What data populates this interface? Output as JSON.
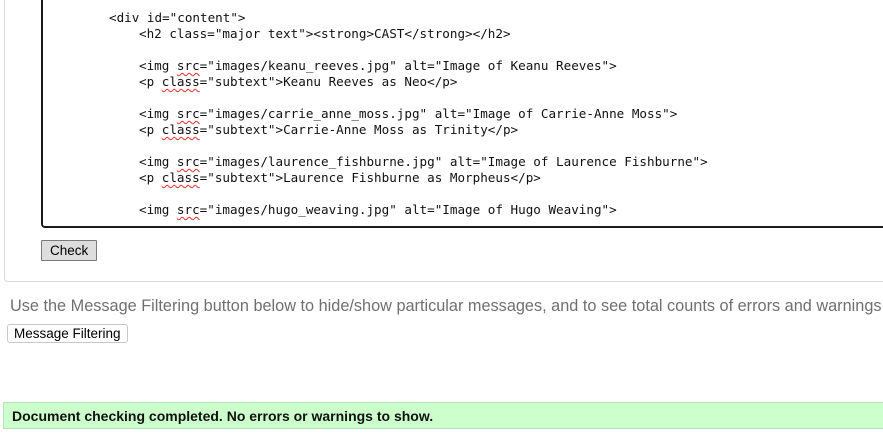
{
  "code_editor": {
    "lines": [
      "<div id=\"content\">",
      "<h2 class=\"major text\"><strong>CAST</strong></h2>",
      "<img src=\"images/keanu_reeves.jpg\" alt=\"Image of Keanu Reeves\">",
      "<p class=\"subtext\">Keanu Reeves as Neo</p>",
      "<img src=\"images/carrie_anne_moss.jpg\" alt=\"Image of Carrie-Anne Moss\">",
      "<p class=\"subtext\">Carrie-Anne Moss as Trinity</p>",
      "<img src=\"images/laurence_fishburne.jpg\" alt=\"Image of Laurence Fishburne\">",
      "<p class=\"subtext\">Laurence Fishburne as Morpheus</p>",
      "<img src=\"images/hugo_weaving.jpg\" alt=\"Image of Hugo Weaving\">"
    ]
  },
  "buttons": {
    "check_label": "Check",
    "message_filtering_label": "Message Filtering"
  },
  "messages": {
    "filter_info": "Use the Message Filtering button below to hide/show particular messages, and to see total counts of errors and warnings.",
    "result": "Document checking completed. No errors or warnings to show."
  },
  "colors": {
    "success_background": "#ccffcc",
    "spellcheck_underline": "#e0312b"
  }
}
